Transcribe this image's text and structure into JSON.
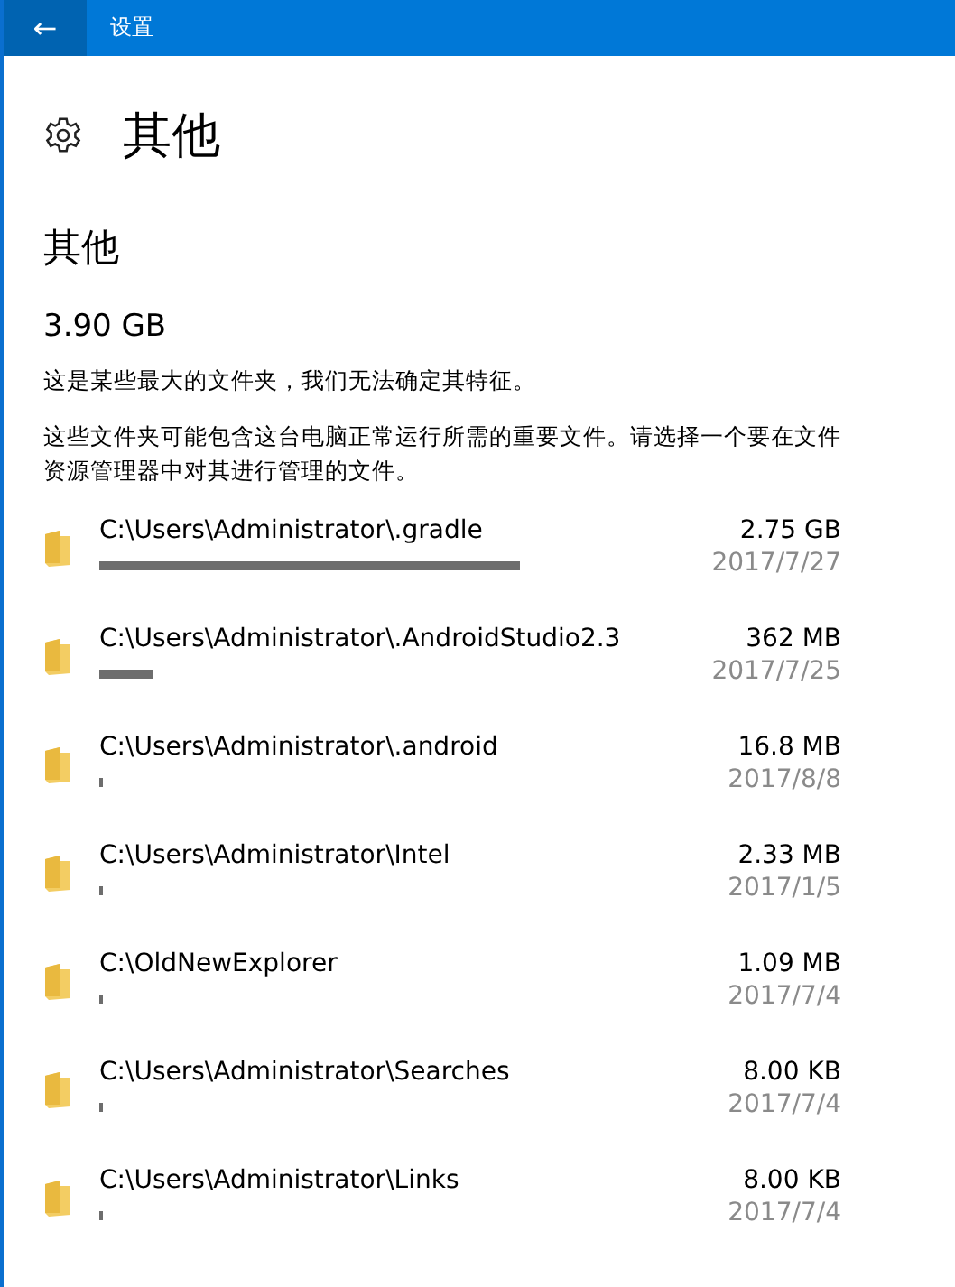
{
  "window": {
    "title": "设置",
    "back": "←"
  },
  "page_title": "其他",
  "section_title": "其他",
  "total": "3.90 GB",
  "notes": [
    "这是某些最大的文件夹，我们无法确定其特征。",
    "这些文件夹可能包含这台电脑正常运行所需的重要文件。请选择一个要在文件资源管理器中对其进行管理的文件。"
  ],
  "folders": [
    {
      "path": "C:\\Users\\Administrator\\.gradle",
      "size": "2.75 GB",
      "date": "2017/7/27"
    },
    {
      "path": "C:\\Users\\Administrator\\.AndroidStudio2.3",
      "size": "362 MB",
      "date": "2017/7/25"
    },
    {
      "path": "C:\\Users\\Administrator\\.android",
      "size": "16.8 MB",
      "date": "2017/8/8"
    },
    {
      "path": "C:\\Users\\Administrator\\Intel",
      "size": "2.33 MB",
      "date": "2017/1/5"
    },
    {
      "path": "C:\\OldNewExplorer",
      "size": "1.09 MB",
      "date": "2017/7/4"
    },
    {
      "path": "C:\\Users\\Administrator\\Searches",
      "size": "8.00 KB",
      "date": "2017/7/4"
    },
    {
      "path": "C:\\Users\\Administrator\\Links",
      "size": "8.00 KB",
      "date": "2017/7/4"
    }
  ]
}
